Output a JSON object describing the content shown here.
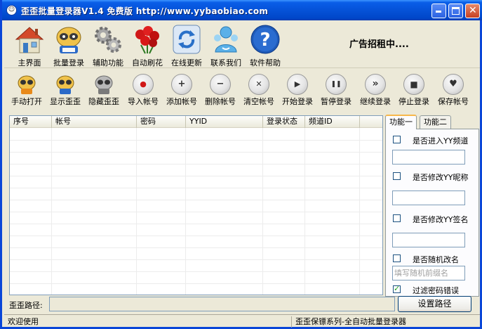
{
  "window": {
    "title": "歪歪批量登录器V1.4 免费版 http://www.yybaobiao.com"
  },
  "main_toolbar": {
    "items": [
      {
        "label": "主界面",
        "icon": "house-icon"
      },
      {
        "label": "批量登录",
        "icon": "raccoon-icon"
      },
      {
        "label": "辅助功能",
        "icon": "gears-icon"
      },
      {
        "label": "自动刷花",
        "icon": "roses-icon"
      },
      {
        "label": "在线更新",
        "icon": "refresh-icon"
      },
      {
        "label": "联系我们",
        "icon": "contact-icon"
      },
      {
        "label": "软件帮助",
        "icon": "help-icon"
      }
    ],
    "ad_text": "广告招租中...."
  },
  "action_toolbar": {
    "items": [
      {
        "label": "手动打开",
        "icon": "raccoon-icon"
      },
      {
        "label": "显示歪歪",
        "icon": "raccoon-icon"
      },
      {
        "label": "隐藏歪歪",
        "icon": "raccoon-gray-icon"
      },
      {
        "label": "导入帐号",
        "icon": "record-icon",
        "glyph": "●"
      },
      {
        "label": "添加帐号",
        "icon": "plus-icon",
        "glyph": "+"
      },
      {
        "label": "删除帐号",
        "icon": "minus-icon",
        "glyph": "−"
      },
      {
        "label": "清空帐号",
        "icon": "x-icon",
        "glyph": "✕"
      },
      {
        "label": "开始登录",
        "icon": "play-icon",
        "glyph": "▶"
      },
      {
        "label": "暂停登录",
        "icon": "pause-icon",
        "glyph": "❚❚"
      },
      {
        "label": "继续登录",
        "icon": "forward-icon",
        "glyph": "»"
      },
      {
        "label": "停止登录",
        "icon": "stop-icon",
        "glyph": "■"
      },
      {
        "label": "保存帐号",
        "icon": "heart-icon",
        "glyph": "♥"
      }
    ]
  },
  "accounts_table": {
    "columns": [
      "序号",
      "帐号",
      "密码",
      "YYID",
      "登录状态",
      "频道ID"
    ],
    "rows": []
  },
  "side_panel": {
    "tabs": [
      "功能一",
      "功能二"
    ],
    "options": [
      {
        "label": "是否进入YY频道",
        "checked": false
      },
      {
        "label": "是否修改YY昵称",
        "checked": false
      },
      {
        "label": "是否修改YY签名",
        "checked": false
      },
      {
        "label": "是否随机改名",
        "checked": false
      },
      {
        "label": "过滤密码错误",
        "checked": true
      }
    ],
    "inputs": [
      {
        "value": "",
        "placeholder": ""
      },
      {
        "value": "",
        "placeholder": ""
      },
      {
        "value": "",
        "placeholder": ""
      },
      {
        "value": "",
        "placeholder": "填写随机前缀名"
      }
    ]
  },
  "path_row": {
    "label": "歪歪路径:",
    "value": "",
    "button": "设置路径"
  },
  "status_bar": {
    "left": "欢迎使用",
    "right": "歪歪保镖系列-全自动批量登录器"
  },
  "colors": {
    "titlebar": "#0552d8",
    "window_bg": "#ece9d8",
    "check_mark": "#21a121"
  }
}
